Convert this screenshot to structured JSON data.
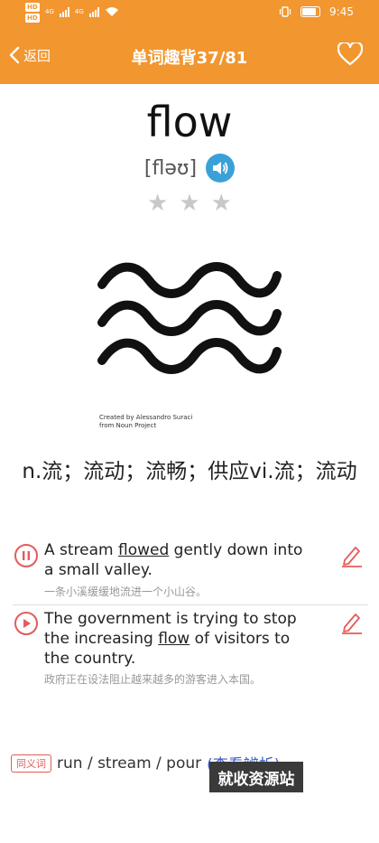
{
  "status_bar": {
    "badges": [
      "HD",
      "HD"
    ],
    "network": "4G",
    "time": "9:45"
  },
  "header": {
    "back_label": "返回",
    "title": "单词趣背37/81",
    "fav_icon": "heart-outline-icon",
    "bg_color": "#f2962f"
  },
  "word": {
    "text": "flow",
    "phonetic": "[fləʊ]",
    "stars": [
      "★",
      "★",
      "★"
    ],
    "illustration_credit_line1": "Created by Alessandro Suraci",
    "illustration_credit_line2": "from Noun Project",
    "definition": "n.流；流动；流畅；供应vi.流；流动"
  },
  "examples": [
    {
      "before": "A stream ",
      "keyword": "flowed",
      "after": " gently down into a small valley.",
      "translation": "一条小溪缓缓地流进一个小山谷。",
      "state_icon": "pause-icon"
    },
    {
      "before": "The government is trying to stop the increasing ",
      "keyword": "flow",
      "after": " of visitors to the country.",
      "translation": "政府正在设法阻止越来越多的游客进入本国。",
      "state_icon": "play-icon"
    }
  ],
  "synonyms": {
    "tag": "同义词",
    "words": "run / stream / pour",
    "link": "(查看辨析)"
  },
  "watermark": "就收资源站"
}
